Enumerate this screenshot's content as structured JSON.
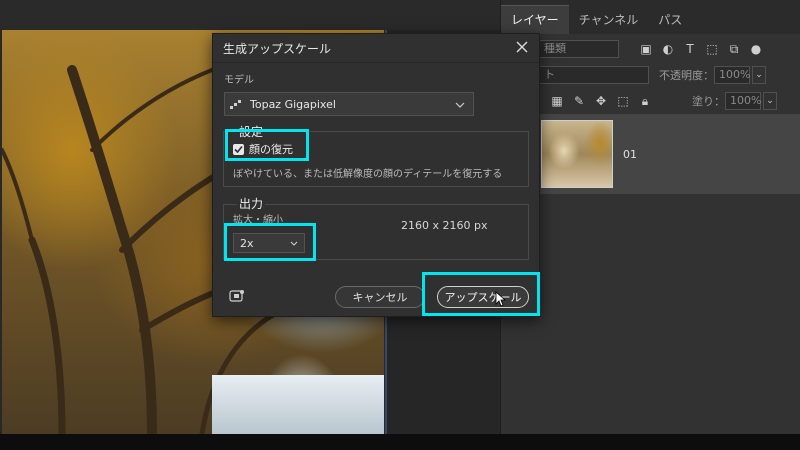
{
  "layers_panel": {
    "tabs": [
      "レイヤー",
      "チャンネル",
      "パス"
    ],
    "kind_placeholder": "種類",
    "blend_mode": "ト",
    "opacity_label": "不透明度：",
    "opacity_value": "100%",
    "lock_label": "：",
    "fill_label": "塗り：",
    "fill_value": "100%",
    "layer_name": "01"
  },
  "dialog": {
    "title": "生成アップスケール",
    "model_label": "モデル",
    "model_value": "Topaz Gigapixel",
    "settings_title": "設定",
    "face_restore_label": "顔の復元",
    "face_restore_checked": true,
    "face_restore_desc": "ぼやけている、または低解像度の顔のディテールを復元する",
    "output_title": "出力",
    "scale_label": "拡大・縮小",
    "scale_value": "2x",
    "output_size": "2160 x 2160 px",
    "cancel_label": "キャンセル",
    "upscale_label": "アップスケール"
  },
  "colors": {
    "highlight": "#00e5ee",
    "dialog_bg": "#303030",
    "panel_bg": "#323232"
  }
}
